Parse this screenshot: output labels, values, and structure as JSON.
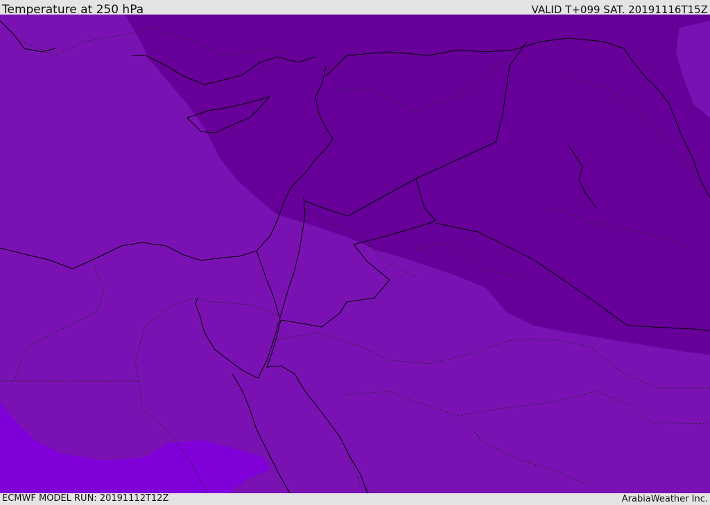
{
  "header": {
    "title": "Temperature at 250 hPa",
    "valid": "VALID T+099 SAT. 20191116T15Z"
  },
  "footer": {
    "model_run": "ECMWF MODEL RUN: 20191112T12Z",
    "credit": "ArabiaWeather Inc."
  },
  "colors": {
    "band_coldest": "#660099",
    "band_cold": "#7a12b3",
    "band_less_cold": "#7f00d9",
    "boundary_line": "#000000"
  }
}
